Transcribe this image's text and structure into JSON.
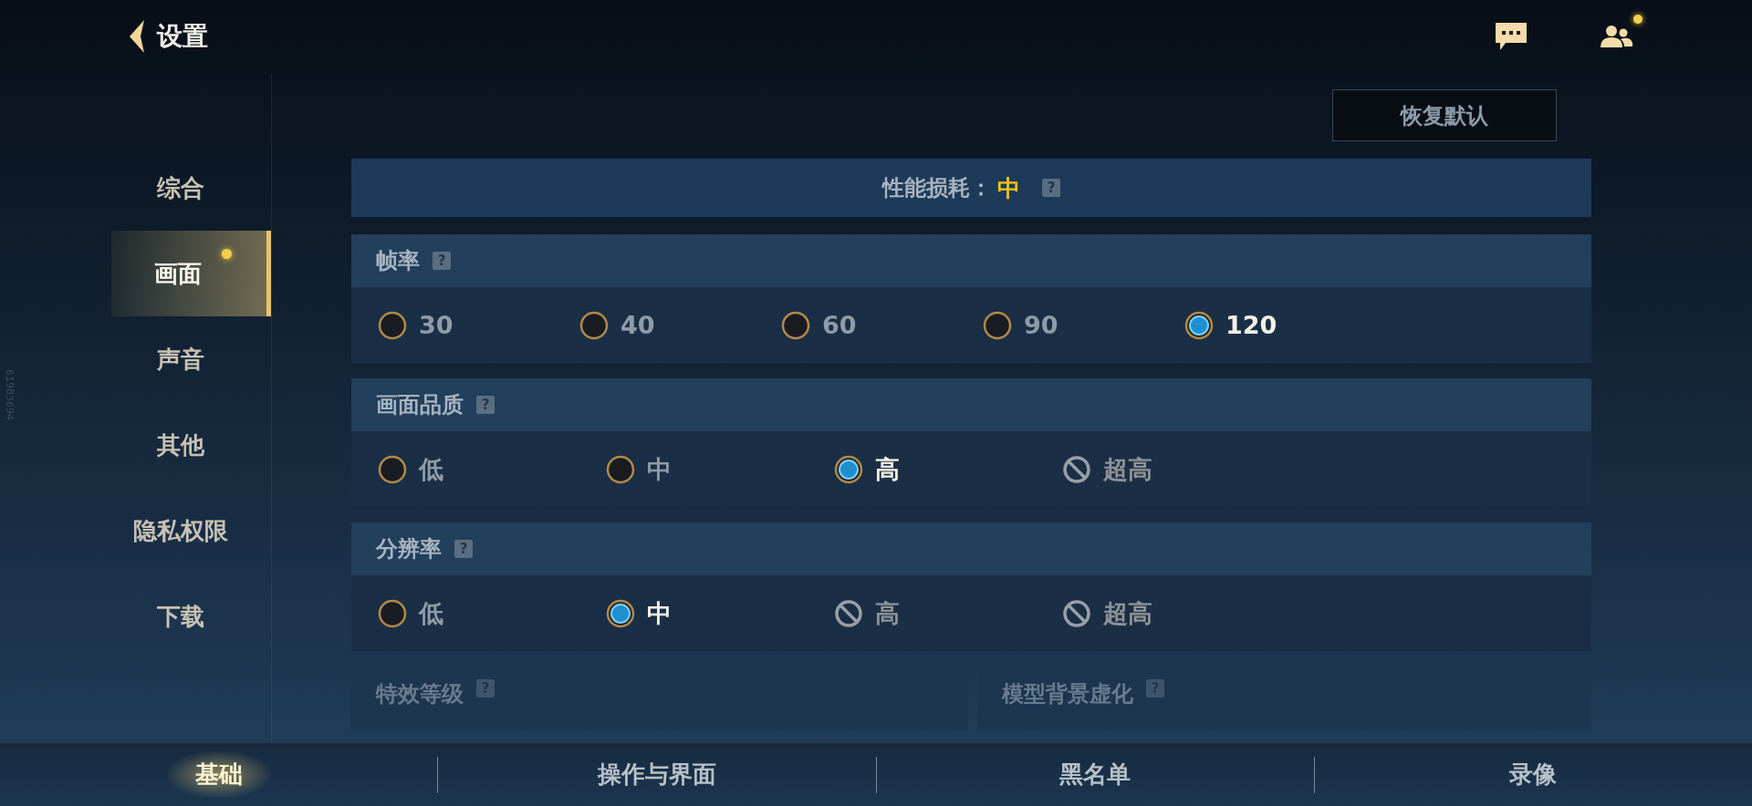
{
  "header": {
    "title": "设置",
    "friends_badge": true
  },
  "restore_button": "恢复默认",
  "side_id": "61983694",
  "sidebar": {
    "items": [
      {
        "label": "综合",
        "selected": false,
        "badge": false
      },
      {
        "label": "画面",
        "selected": true,
        "badge": true
      },
      {
        "label": "声音",
        "selected": false,
        "badge": false
      },
      {
        "label": "其他",
        "selected": false,
        "badge": false
      },
      {
        "label": "隐私权限",
        "selected": false,
        "badge": false
      },
      {
        "label": "下载",
        "selected": false,
        "badge": false
      }
    ]
  },
  "performance": {
    "label": "性能损耗：",
    "value": "中",
    "help": "?"
  },
  "sections": [
    {
      "title": "帧率",
      "help": "?",
      "options": [
        {
          "label": "30",
          "selected": false,
          "disabled": false
        },
        {
          "label": "40",
          "selected": false,
          "disabled": false
        },
        {
          "label": "60",
          "selected": false,
          "disabled": false
        },
        {
          "label": "90",
          "selected": false,
          "disabled": false
        },
        {
          "label": "120",
          "selected": true,
          "disabled": false
        }
      ]
    },
    {
      "title": "画面品质",
      "help": "?",
      "options": [
        {
          "label": "低",
          "selected": false,
          "disabled": false
        },
        {
          "label": "中",
          "selected": false,
          "disabled": false
        },
        {
          "label": "高",
          "selected": true,
          "disabled": false
        },
        {
          "label": "超高",
          "selected": false,
          "disabled": true
        }
      ]
    },
    {
      "title": "分辨率",
      "help": "?",
      "options": [
        {
          "label": "低",
          "selected": false,
          "disabled": false
        },
        {
          "label": "中",
          "selected": true,
          "disabled": false
        },
        {
          "label": "高",
          "selected": false,
          "disabled": true
        },
        {
          "label": "超高",
          "selected": false,
          "disabled": true
        }
      ]
    }
  ],
  "partial_sections": [
    {
      "title": "特效等级",
      "help": "?"
    },
    {
      "title": "模型背景虚化",
      "help": "?"
    }
  ],
  "bottom_tabs": [
    {
      "label": "基础",
      "selected": true
    },
    {
      "label": "操作与界面",
      "selected": false
    },
    {
      "label": "黑名单",
      "selected": false
    },
    {
      "label": "录像",
      "selected": false
    }
  ]
}
